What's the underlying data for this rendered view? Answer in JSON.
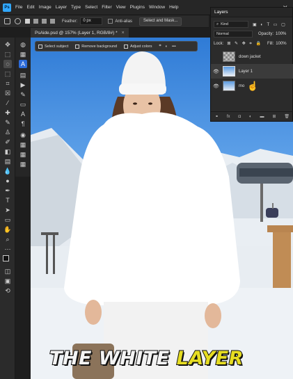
{
  "menubar": {
    "logo": "Ps",
    "items": [
      "File",
      "Edit",
      "Image",
      "Layer",
      "Type",
      "Select",
      "Filter",
      "View",
      "Plugins",
      "Window",
      "Help"
    ]
  },
  "options": {
    "feather_label": "Feather:",
    "feather_value": "0 px",
    "antialias_label": "Anti-alias",
    "select_mask_label": "Select and Mask..."
  },
  "document": {
    "tab_title": "PsAide.psd @ 157% (Layer 1, RGB/8#) *"
  },
  "context_bar": {
    "select_subject": "Select subject",
    "remove_background": "Remove background",
    "adjust_colors": "Adjust colors"
  },
  "layers_panel": {
    "title": "Layers",
    "kind_label": "Kind",
    "blend_mode": "Normal",
    "opacity_label": "Opacity:",
    "opacity_value": "100%",
    "lock_label": "Lock:",
    "fill_label": "Fill:",
    "fill_value": "100%",
    "layers": [
      {
        "name": "down jacket",
        "visible": false
      },
      {
        "name": "Layer 1",
        "visible": true
      },
      {
        "name": "mo",
        "visible": true
      }
    ]
  },
  "caption": {
    "white_part": "THE WHITE",
    "yellow_part": "LAYER"
  },
  "colors": {
    "accent": "#31a8ff",
    "caption_yellow": "#e6dd22"
  }
}
